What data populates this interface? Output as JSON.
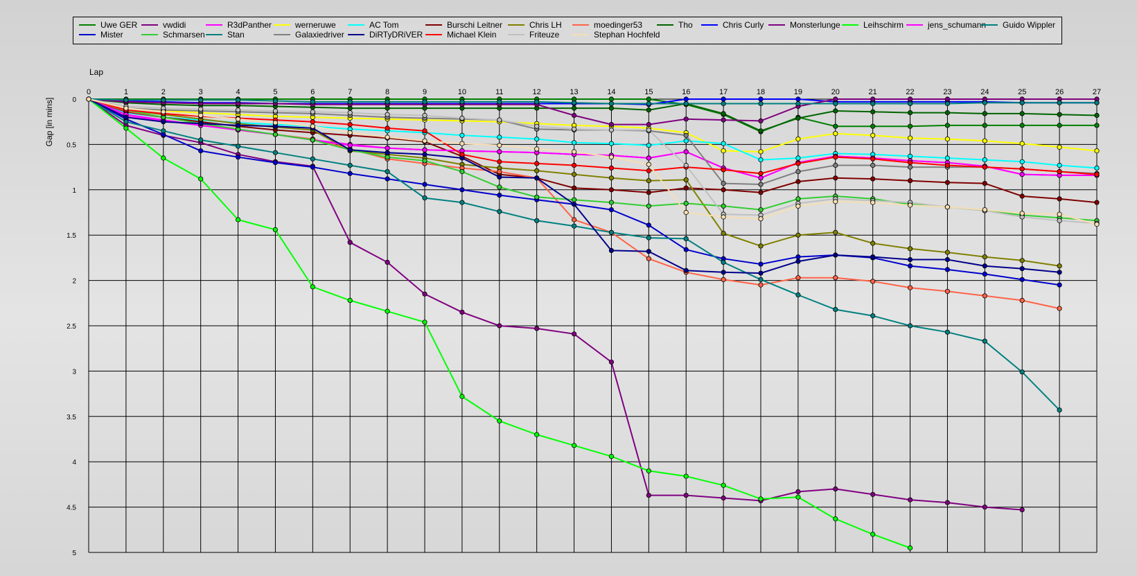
{
  "chart_data": {
    "type": "line",
    "xlabel": "Lap",
    "ylabel": "Gap [in mins]",
    "xlim": [
      0,
      27
    ],
    "ylim": [
      0,
      5
    ],
    "y_inverted": true,
    "grid": true,
    "legend_position": "top",
    "x": [
      0,
      1,
      2,
      3,
      4,
      5,
      6,
      7,
      8,
      9,
      10,
      11,
      12,
      13,
      14,
      15,
      16,
      17,
      18,
      19,
      20,
      21,
      22,
      23,
      24,
      25,
      26,
      27
    ],
    "x_ticks": [
      0,
      1,
      2,
      3,
      4,
      5,
      6,
      7,
      8,
      9,
      10,
      11,
      12,
      13,
      14,
      15,
      16,
      17,
      18,
      19,
      20,
      21,
      22,
      23,
      24,
      25,
      26,
      27
    ],
    "y_ticks": [
      0,
      0.5,
      1,
      1.5,
      2,
      2.5,
      3,
      3.5,
      4,
      4.5,
      5
    ],
    "series": [
      {
        "name": "Uwe GER",
        "color": "#008000",
        "values": [
          0,
          0,
          0,
          0,
          0,
          0,
          0,
          0,
          0,
          0,
          0,
          0,
          0,
          0,
          0,
          0,
          0.06,
          0.17,
          0.36,
          0.2,
          0.3,
          0.3,
          0.3,
          0.29,
          0.29,
          0.29,
          0.29,
          0.29
        ]
      },
      {
        "name": "vwdidi",
        "color": "#800080",
        "values": [
          0,
          0.29,
          0.4,
          0.48,
          0.61,
          0.69,
          0.74,
          1.58,
          1.8,
          2.15,
          2.35,
          2.5,
          2.53,
          2.59,
          2.9,
          4.37,
          4.37,
          4.4,
          4.43,
          4.33,
          4.3,
          4.36,
          4.42,
          4.45,
          4.5,
          4.53,
          null,
          null
        ]
      },
      {
        "name": "R3dPanther",
        "color": "#ff00ff",
        "values": [
          0,
          0.19,
          0.24,
          0.29,
          0.34,
          0.39,
          0.45,
          0.5,
          0.54,
          0.56,
          0.57,
          0.58,
          0.59,
          0.61,
          0.62,
          0.65,
          0.58,
          0.76,
          0.87,
          0.7,
          0.63,
          0.65,
          0.68,
          0.7,
          0.74,
          0.83,
          0.84,
          0.84
        ]
      },
      {
        "name": "werneruwe",
        "color": "#ffff00",
        "values": [
          0,
          0.1,
          0.13,
          0.15,
          0.17,
          0.19,
          0.2,
          0.21,
          0.22,
          0.23,
          0.24,
          0.25,
          0.27,
          0.29,
          0.3,
          0.32,
          0.37,
          0.57,
          0.58,
          0.44,
          0.38,
          0.4,
          0.43,
          0.44,
          0.46,
          0.49,
          0.53,
          0.57
        ]
      },
      {
        "name": "AC Tom",
        "color": "#00ffff",
        "values": [
          0,
          0.15,
          0.2,
          0.23,
          0.26,
          0.28,
          0.3,
          0.33,
          0.35,
          0.37,
          0.4,
          0.42,
          0.44,
          0.48,
          0.49,
          0.51,
          0.46,
          0.49,
          0.67,
          0.65,
          0.6,
          0.61,
          0.63,
          0.65,
          0.67,
          0.69,
          0.73,
          0.76
        ]
      },
      {
        "name": "Burschi Leitner",
        "color": "#800000",
        "values": [
          0,
          0.14,
          0.2,
          0.25,
          0.3,
          0.34,
          0.37,
          0.4,
          0.43,
          0.47,
          0.63,
          0.83,
          0.87,
          0.98,
          1.0,
          1.03,
          0.98,
          1.0,
          1.03,
          0.91,
          0.87,
          0.88,
          0.9,
          0.92,
          0.93,
          1.07,
          1.1,
          1.14
        ]
      },
      {
        "name": "Chris LH",
        "color": "#808000",
        "values": [
          0,
          0.12,
          0.17,
          0.22,
          0.27,
          0.31,
          0.34,
          0.57,
          0.61,
          0.65,
          0.72,
          0.76,
          0.79,
          0.83,
          0.87,
          0.9,
          0.89,
          1.48,
          1.62,
          1.5,
          1.47,
          1.59,
          1.65,
          1.69,
          1.74,
          1.78,
          1.84,
          null
        ]
      },
      {
        "name": "moedinger53",
        "color": "#ff6347",
        "values": [
          0,
          0.13,
          0.2,
          0.27,
          0.34,
          0.39,
          0.44,
          0.55,
          0.66,
          0.71,
          0.76,
          0.8,
          0.87,
          1.33,
          1.47,
          1.76,
          1.91,
          1.99,
          2.05,
          1.97,
          1.97,
          2.01,
          2.08,
          2.12,
          2.17,
          2.22,
          2.31,
          null
        ]
      },
      {
        "name": "Tho",
        "color": "#006400",
        "values": [
          0,
          0.04,
          0.06,
          0.07,
          0.07,
          0.08,
          0.09,
          0.1,
          0.1,
          0.1,
          0.1,
          0.1,
          0.1,
          0.1,
          0.1,
          0.12,
          0.05,
          0.16,
          0.35,
          0.21,
          0.13,
          0.14,
          0.15,
          0.15,
          0.16,
          0.16,
          0.17,
          0.18
        ]
      },
      {
        "name": "Chris Curly",
        "color": "#0000ff",
        "values": [
          0,
          0.02,
          0.03,
          0.04,
          0.04,
          0.05,
          0.05,
          0.05,
          0.05,
          0.05,
          0.05,
          0.05,
          0.05,
          0.05,
          0.05,
          0.06,
          0,
          0,
          0,
          0,
          0.03,
          0.03,
          0.03,
          0.03,
          0.03,
          0.04,
          0.04,
          0.04
        ]
      },
      {
        "name": "Monsterlunge",
        "color": "#800080",
        "values": [
          0,
          0.03,
          0.04,
          0.05,
          0.05,
          0.05,
          0.06,
          0.06,
          0.06,
          0.06,
          0.06,
          0.06,
          0.06,
          0.18,
          0.28,
          0.28,
          0.22,
          0.23,
          0.24,
          0.08,
          0,
          0,
          0,
          0,
          0,
          0,
          0,
          0
        ]
      },
      {
        "name": "Leihschirm",
        "color": "#00ff00",
        "values": [
          0,
          0.32,
          0.65,
          0.88,
          1.33,
          1.44,
          2.07,
          2.22,
          2.34,
          2.46,
          3.28,
          3.55,
          3.7,
          3.82,
          3.94,
          4.1,
          4.16,
          4.26,
          4.41,
          4.39,
          4.63,
          4.8,
          4.95,
          null,
          null,
          null,
          null,
          null
        ]
      },
      {
        "name": "jens_schumann",
        "color": "#ff00ff",
        "values": [
          0,
          0.17,
          0.23,
          0.29,
          0.34,
          0.39,
          0.45,
          0.51,
          0.54,
          0.56,
          0.57,
          0.58,
          0.59,
          0.61,
          0.62,
          0.65,
          0.58,
          0.76,
          0.87,
          0.7,
          0.63,
          0.65,
          0.68,
          0.7,
          0.74,
          0.83,
          0.84,
          0.84
        ]
      },
      {
        "name": "Guido Wippler",
        "color": "#008080",
        "values": [
          0,
          0.01,
          0.01,
          0.01,
          0.01,
          0.02,
          0.03,
          0.03,
          0.03,
          0.03,
          0.03,
          0.03,
          0.03,
          0.04,
          0.05,
          0.05,
          0.05,
          0.05,
          0.05,
          0.05,
          0.05,
          0.05,
          0.05,
          0.05,
          0.04,
          0.04,
          0.04,
          0.04
        ]
      },
      {
        "name": "Mister",
        "color": "#0000cd",
        "values": [
          0,
          0.22,
          0.39,
          0.57,
          0.64,
          0.7,
          0.75,
          0.82,
          0.88,
          0.94,
          1.0,
          1.06,
          1.11,
          1.16,
          1.22,
          1.39,
          1.66,
          1.76,
          1.82,
          1.74,
          1.72,
          1.75,
          1.84,
          1.88,
          1.93,
          1.99,
          2.05,
          null
        ]
      },
      {
        "name": "Schmarsen",
        "color": "#32cd32",
        "values": [
          0,
          0.12,
          0.2,
          0.27,
          0.33,
          0.39,
          0.45,
          0.56,
          0.64,
          0.68,
          0.8,
          0.97,
          1.08,
          1.11,
          1.14,
          1.18,
          1.15,
          1.18,
          1.22,
          1.1,
          1.07,
          1.1,
          1.16,
          1.19,
          1.23,
          1.28,
          1.31,
          1.34
        ]
      },
      {
        "name": "Stan",
        "color": "#008080",
        "values": [
          0,
          0.25,
          0.35,
          0.45,
          0.52,
          0.59,
          0.66,
          0.73,
          0.8,
          1.09,
          1.14,
          1.24,
          1.34,
          1.4,
          1.47,
          1.53,
          1.54,
          1.8,
          1.99,
          2.16,
          2.32,
          2.39,
          2.5,
          2.57,
          2.67,
          3.01,
          3.43,
          null
        ]
      },
      {
        "name": "Galaxiedriver",
        "color": "#808080",
        "values": [
          0,
          0.1,
          0.12,
          0.13,
          0.14,
          0.15,
          0.16,
          0.18,
          0.2,
          0.21,
          0.22,
          0.23,
          0.33,
          0.34,
          0.34,
          0.35,
          0.4,
          0.93,
          0.94,
          0.8,
          0.73,
          0.73,
          0.75,
          0.75,
          0.75,
          0.77,
          0.8,
          0.82
        ]
      },
      {
        "name": "DiRTyDRiVER",
        "color": "#00008b",
        "values": [
          0,
          0.2,
          0.25,
          0.27,
          0.29,
          0.3,
          0.32,
          0.56,
          0.59,
          0.61,
          0.65,
          0.86,
          0.87,
          1.16,
          1.67,
          1.68,
          1.89,
          1.91,
          1.92,
          1.79,
          1.72,
          1.74,
          1.77,
          1.77,
          1.84,
          1.87,
          1.91,
          null
        ]
      },
      {
        "name": "Michael Klein",
        "color": "#ff0000",
        "values": [
          0,
          0.12,
          0.16,
          0.19,
          0.21,
          0.23,
          0.25,
          0.28,
          0.32,
          0.35,
          0.61,
          0.69,
          0.71,
          0.73,
          0.76,
          0.79,
          0.75,
          0.78,
          0.82,
          0.71,
          0.64,
          0.66,
          0.7,
          0.73,
          0.75,
          0.77,
          0.8,
          0.83
        ]
      },
      {
        "name": "Friteuze",
        "color": "#c0c0c0",
        "values": [
          0,
          0.08,
          0.1,
          0.11,
          0.12,
          0.13,
          0.14,
          0.15,
          0.17,
          0.18,
          0.21,
          0.23,
          0.3,
          0.33,
          0.34,
          0.34,
          0.73,
          1.27,
          1.28,
          1.15,
          1.1,
          1.12,
          1.14,
          1.19,
          1.23,
          1.3,
          1.34,
          1.37
        ]
      },
      {
        "name": "Stephan Hochfeld",
        "color": "#f5deb3",
        "values": [
          0,
          0.1,
          0.14,
          0.18,
          0.22,
          0.26,
          0.3,
          0.37,
          0.42,
          0.46,
          0.49,
          0.51,
          0.55,
          0.58,
          0.64,
          0.72,
          1.25,
          1.3,
          1.32,
          1.18,
          1.13,
          1.14,
          1.17,
          1.19,
          1.22,
          1.26,
          1.27,
          1.38
        ]
      }
    ]
  }
}
